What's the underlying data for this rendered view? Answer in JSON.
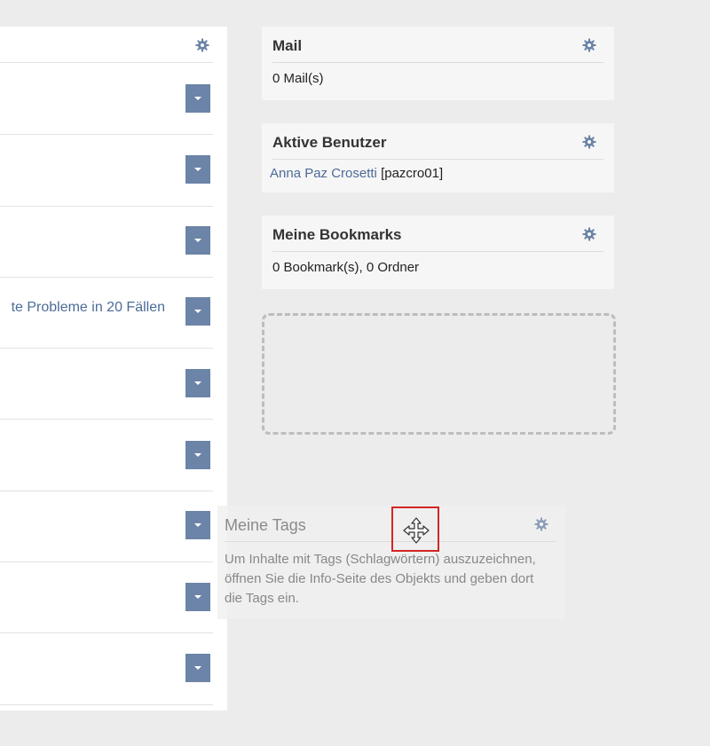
{
  "main_panel": {
    "row_count": 9,
    "row_links": [
      "",
      "",
      "",
      "te Probleme in 20 Fällen",
      "",
      "",
      "",
      "",
      ""
    ]
  },
  "blocks": {
    "mail": {
      "title": "Mail",
      "body": "0 Mail(s)"
    },
    "active_users": {
      "title": "Aktive Benutzer",
      "user_name": "Anna Paz Crosetti",
      "user_login": "[pazcro01]"
    },
    "bookmarks": {
      "title": "Meine Bookmarks",
      "body": "0 Bookmark(s), 0 Ordner"
    },
    "tags": {
      "title": "Meine Tags",
      "body": "Um Inhalte mit Tags (Schlagwörtern) auszuzeichnen, öffnen Sie die Info-Seite des Objekts und geben dort die Tags ein."
    }
  },
  "icons": {
    "settings": "gear-icon",
    "dropdown": "caret-down-icon",
    "cursor": "move-cursor-icon"
  },
  "colors": {
    "accent": "#6b84a7",
    "link": "#4c6b98",
    "highlight": "#d42525"
  }
}
